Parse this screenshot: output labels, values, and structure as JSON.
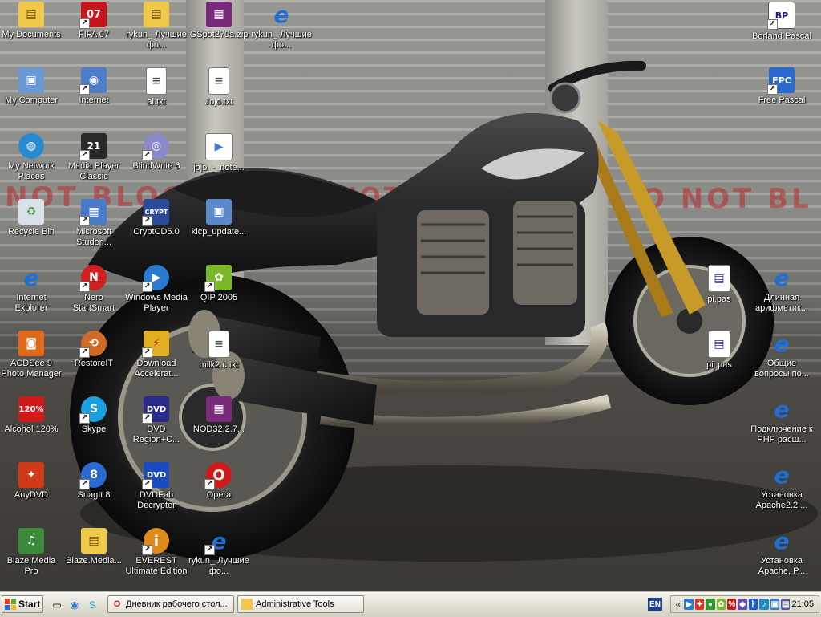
{
  "desktop": {
    "wallpaper_stencil": [
      "NOT BLOCK",
      "NOT BLOCK",
      "O NOT BL"
    ],
    "icons": [
      {
        "label": "My Documents",
        "icon": "folder-icon",
        "color": "#f0c84a"
      },
      {
        "label": "FIFA 07",
        "icon": "fifa-icon",
        "color": "#c8151b"
      },
      {
        "label": "rykun_ Лучшие фо...",
        "icon": "folder-icon",
        "color": "#f0c84a"
      },
      {
        "label": "GSpot270a.zip",
        "icon": "winrar-icon",
        "color": "#7a2a7a"
      },
      {
        "label": "rykun_ Лучшие фо...",
        "icon": "ie-icon",
        "color": "#1e6fd6"
      },
      {
        "label": "Borland Pascal",
        "icon": "borland-icon",
        "color": "#ffffff"
      },
      {
        "label": "My Computer",
        "icon": "computer-icon",
        "color": "#6a9ad6"
      },
      {
        "label": "Internet",
        "icon": "internet-icon",
        "color": "#4d7fc8"
      },
      {
        "label": "ai.txt",
        "icon": "text-file-icon",
        "color": "#ffffff"
      },
      {
        "label": "Jojo.txt",
        "icon": "text-file-icon",
        "color": "#ffffff"
      },
      {
        "label": "Free Pascal",
        "icon": "pascal-icon",
        "color": "#2a6ad0"
      },
      {
        "label": "My Network Places",
        "icon": "network-icon",
        "color": "#2a8ad0"
      },
      {
        "label": "Media Player Classic",
        "icon": "media-player-classic-icon",
        "color": "#2a2a2a"
      },
      {
        "label": "BlindWrite 6",
        "icon": "blindwrite-icon",
        "color": "#8a8acc"
      },
      {
        "label": "jojo_-_note...",
        "icon": "media-file-icon",
        "color": "#3a7ad0"
      },
      {
        "label": "Recycle Bin",
        "icon": "recycle-bin-icon",
        "color": "#4a9a4a"
      },
      {
        "label": "Microsoft Studen...",
        "icon": "microsoft-student-icon",
        "color": "#4a7acc"
      },
      {
        "label": "CryptCD5.0",
        "icon": "cryptcd-icon",
        "color": "#2a4a9a"
      },
      {
        "label": "klcp_update...",
        "icon": "codec-installer-icon",
        "color": "#5a8aca"
      },
      {
        "label": "Internet Explorer",
        "icon": "ie-icon",
        "color": "#1e6fd6"
      },
      {
        "label": "Nero StartSmart",
        "icon": "nero-icon",
        "color": "#d02020"
      },
      {
        "label": "Windows Media Player",
        "icon": "windows-media-player-icon",
        "color": "#2a7ad0"
      },
      {
        "label": "QIP 2005",
        "icon": "qip-icon",
        "color": "#7ab82a"
      },
      {
        "label": "pi.pas",
        "icon": "pascal-file-icon",
        "color": "#ffffff"
      },
      {
        "label": "Длинная арифметик...",
        "icon": "ie-icon",
        "color": "#1e6fd6"
      },
      {
        "label": "ACDSee 9 Photo Manager",
        "icon": "acdsee-icon",
        "color": "#e06a1a"
      },
      {
        "label": "RestoreIT",
        "icon": "restoreit-icon",
        "color": "#d06a2a"
      },
      {
        "label": "Download Accelerat...",
        "icon": "download-accelerator-icon",
        "color": "#e0b020"
      },
      {
        "label": "milk2.c.txt",
        "icon": "text-file-icon",
        "color": "#ffffff"
      },
      {
        "label": "pij.pas",
        "icon": "pascal-file-icon",
        "color": "#ffffff"
      },
      {
        "label": "Общие вопросы по...",
        "icon": "ie-icon",
        "color": "#1e6fd6"
      },
      {
        "label": "Alcohol 120%",
        "icon": "alcohol-icon",
        "color": "#d01a1a"
      },
      {
        "label": "Skype",
        "icon": "skype-icon",
        "color": "#1aa0e0"
      },
      {
        "label": "DVD Region+C...",
        "icon": "dvd-region-icon",
        "color": "#2a2a8a"
      },
      {
        "label": "NOD32.2.7...",
        "icon": "winrar-icon",
        "color": "#7a2a7a"
      },
      {
        "label": "Подключение к PHP расш...",
        "icon": "ie-icon",
        "color": "#1e6fd6"
      },
      {
        "label": "AnyDVD",
        "icon": "anydvd-icon",
        "color": "#d03a1a"
      },
      {
        "label": "SnagIt 8",
        "icon": "snagit-icon",
        "color": "#2a6ad0"
      },
      {
        "label": "DVDFab Decrypter",
        "icon": "dvdfab-icon",
        "color": "#1a4ac0"
      },
      {
        "label": "Opera",
        "icon": "opera-icon",
        "color": "#d01a1a"
      },
      {
        "label": "Установка Apache2.2 ...",
        "icon": "ie-icon",
        "color": "#1e6fd6"
      },
      {
        "label": "Blaze Media Pro",
        "icon": "blaze-media-icon",
        "color": "#3a8a3a"
      },
      {
        "label": "Blaze.Media...",
        "icon": "folder-icon",
        "color": "#f0c84a"
      },
      {
        "label": "EVEREST Ultimate Edition",
        "icon": "everest-icon",
        "color": "#e08a1a"
      },
      {
        "label": "rykun_ Лучшие фо...",
        "icon": "ie-icon",
        "color": "#1e6fd6"
      },
      {
        "label": "Установка Apache, P...",
        "icon": "ie-icon",
        "color": "#1e6fd6"
      }
    ]
  },
  "taskbar": {
    "start_label": "Start",
    "quick_launch": [
      {
        "icon": "show-desktop-icon"
      },
      {
        "icon": "media-player-icon"
      },
      {
        "icon": "skype-icon"
      }
    ],
    "tasks": [
      {
        "label": "Дневник рабочего стол...",
        "icon": "opera-icon"
      },
      {
        "label": "Administrative Tools",
        "icon": "folder-icon"
      }
    ],
    "language": "EN",
    "clock": "21:05",
    "tray_icons": [
      {
        "icon": "expand-tray-icon",
        "color": "#555555"
      },
      {
        "icon": "media-tray-icon",
        "color": "#2a7ad0"
      },
      {
        "icon": "anydvd-tray-icon",
        "color": "#d03a1a"
      },
      {
        "icon": "antivirus-tray-icon",
        "color": "#2a9a2a"
      },
      {
        "icon": "qip-tray-icon",
        "color": "#7ab82a"
      },
      {
        "icon": "alcohol-tray-icon",
        "color": "#c01a1a"
      },
      {
        "icon": "restore-tray-icon",
        "color": "#6a4ab0"
      },
      {
        "icon": "bluetooth-tray-icon",
        "color": "#1a5ad0"
      },
      {
        "icon": "volume-tray-icon",
        "color": "#1a8ac0"
      },
      {
        "icon": "network-tray-icon",
        "color": "#3a7ad0"
      },
      {
        "icon": "language-tray-icon",
        "color": "#5a5a9a"
      }
    ]
  }
}
